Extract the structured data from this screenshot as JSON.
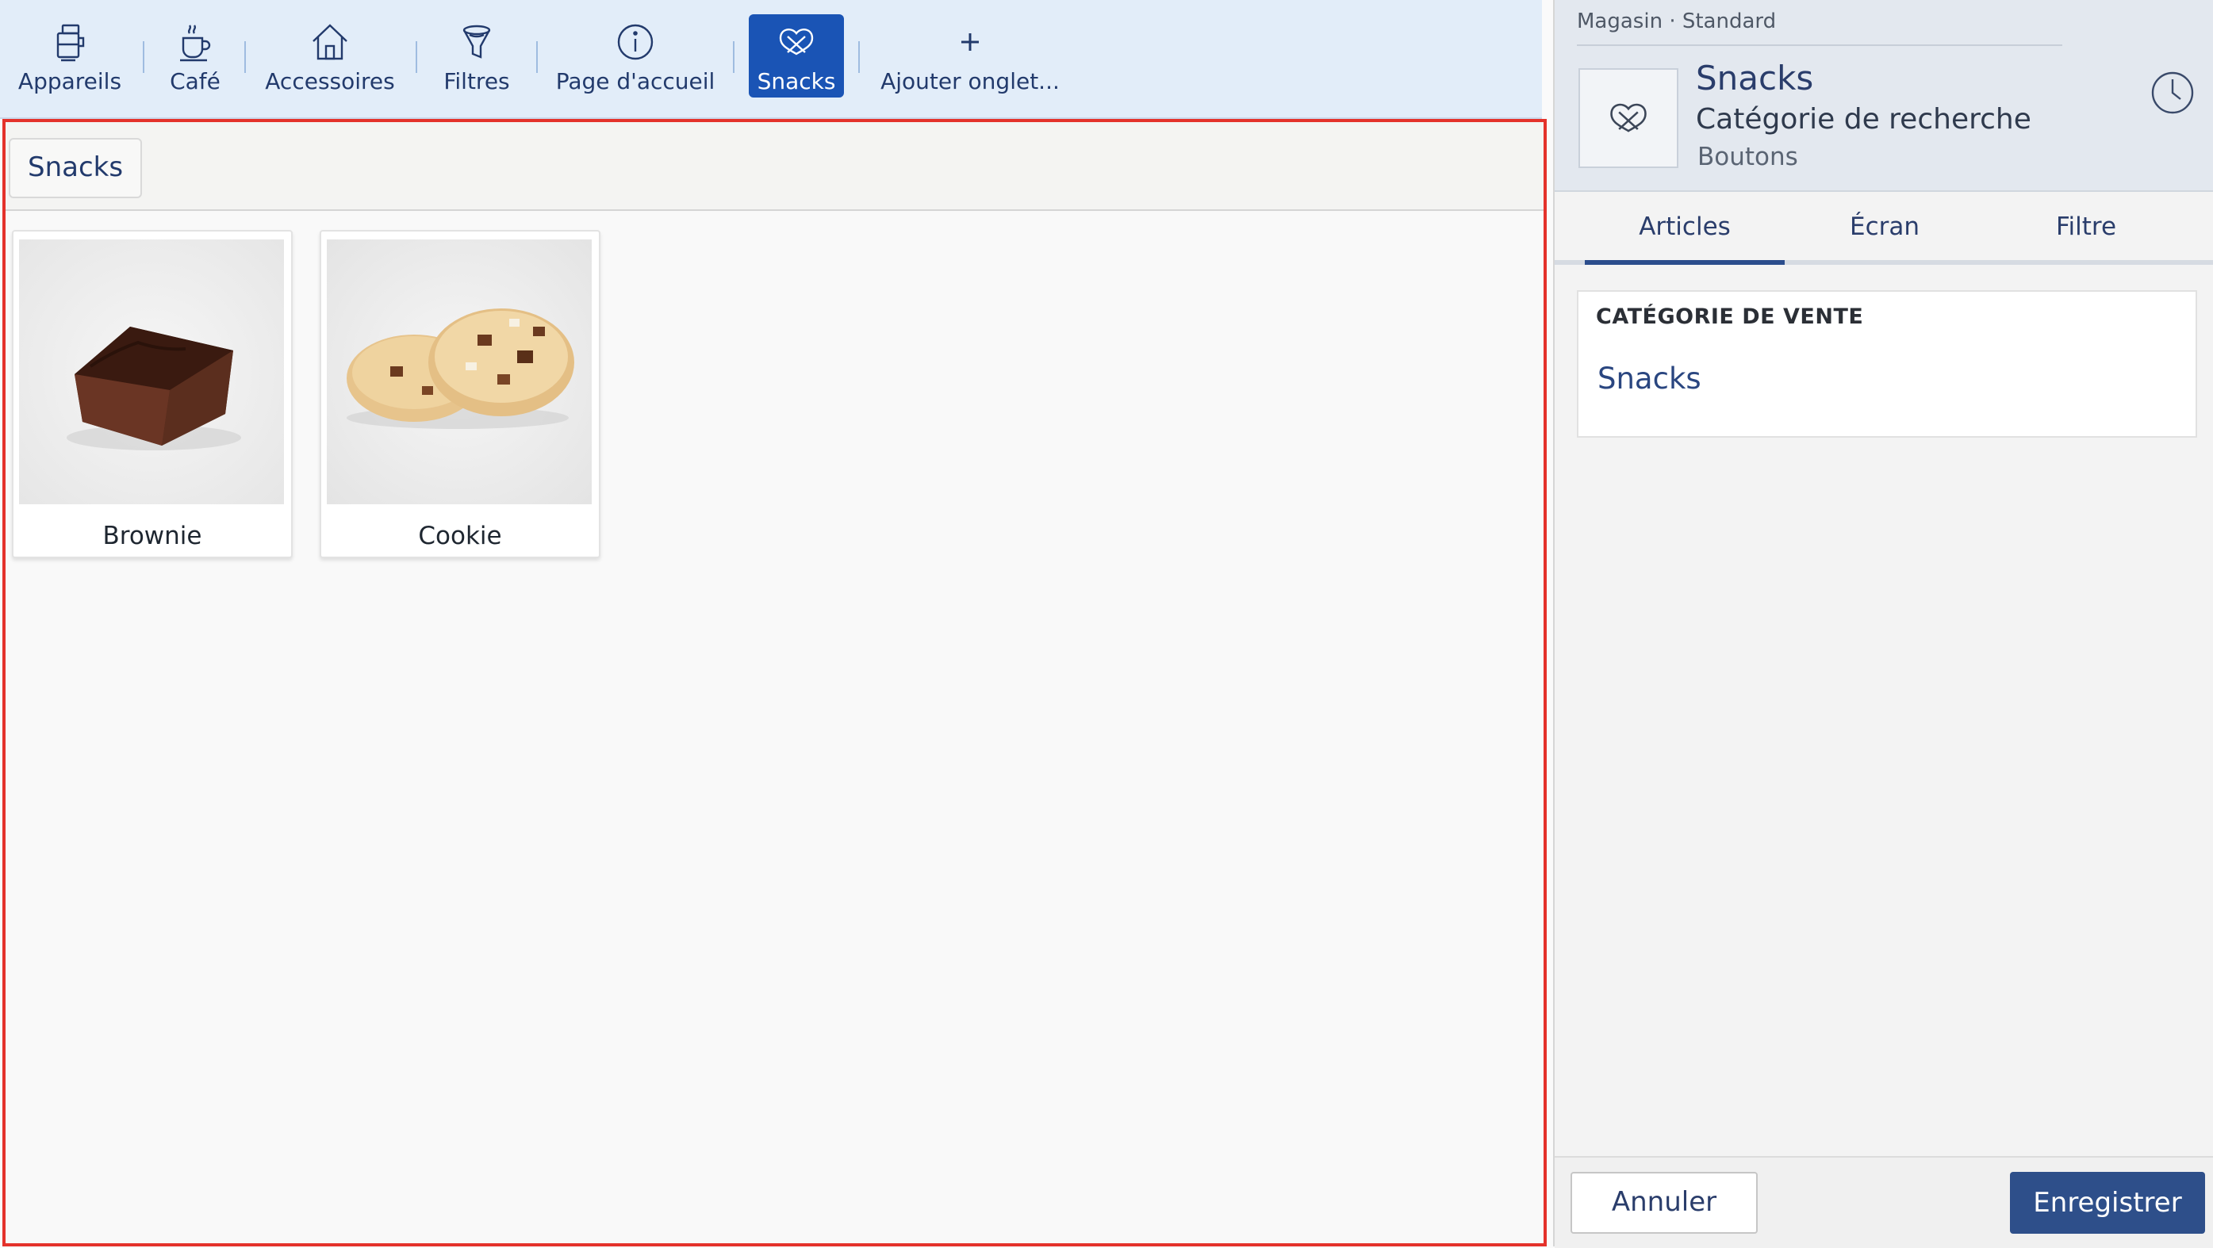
{
  "tabs": [
    {
      "label": "Appareils",
      "icon": "appliance-icon"
    },
    {
      "label": "Café",
      "icon": "coffee-cup-icon"
    },
    {
      "label": "Accessoires",
      "icon": "house-icon"
    },
    {
      "label": "Filtres",
      "icon": "filter-funnel-icon"
    },
    {
      "label": "Page d'accueil",
      "icon": "info-icon"
    },
    {
      "label": "Snacks",
      "icon": "pretzel-icon",
      "active": true
    },
    {
      "label": "Ajouter onglet...",
      "icon": "plus-icon"
    }
  ],
  "main": {
    "filter_chip": "Snacks",
    "products": [
      {
        "name": "Brownie",
        "image": "brownie-image"
      },
      {
        "name": "Cookie",
        "image": "cookie-image"
      }
    ]
  },
  "panel": {
    "breadcrumb": "Magasin · Standard",
    "title": "Snacks",
    "subtitle": "Catégorie de recherche",
    "subtitle2": "Boutons",
    "tabs": [
      "Articles",
      "Écran",
      "Filtre"
    ],
    "active_tab": "Articles",
    "section_title": "CATÉGORIE DE VENTE",
    "section_value": "Snacks",
    "cancel_label": "Annuler",
    "save_label": "Enregistrer"
  },
  "colors": {
    "accent": "#1a54b5",
    "topbar_bg": "#e2edf9",
    "highlight_border": "#e4322b",
    "save_button": "#2e4f8a"
  }
}
